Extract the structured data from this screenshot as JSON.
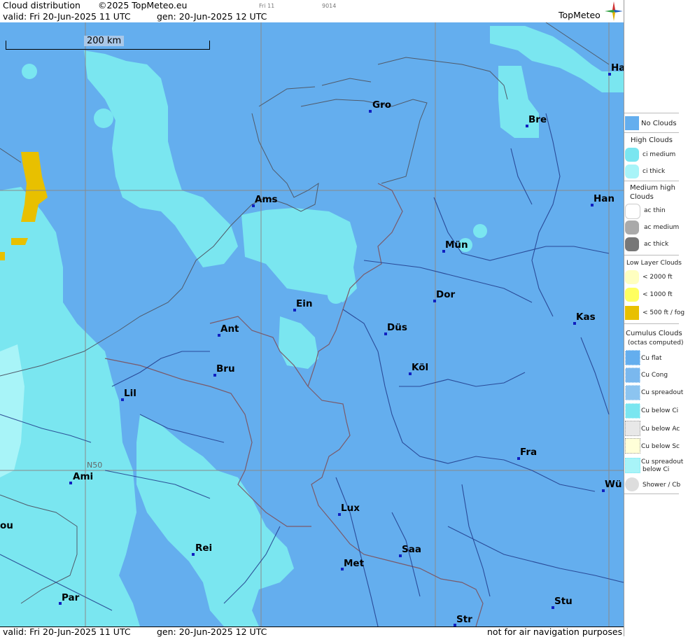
{
  "header": {
    "title": "Cloud distribution",
    "copyright": "©2025 TopMeteo.eu",
    "tab_code": "Fri 11",
    "map_code": "9014",
    "valid": "valid:  Fri  20-Jun-2025  11 UTC",
    "gen": "gen: 20-Jun-2025 12 UTC",
    "brand": "TopMeteo"
  },
  "footer": {
    "valid": "valid:  Fri  20-Jun-2025  11 UTC",
    "gen": "gen: 20-Jun-2025 12 UTC",
    "disclaimer": "not for air navigation purposes"
  },
  "map": {
    "scale_label": "200 km",
    "latitude_label": "N50",
    "cities": [
      "Gro",
      "Bre",
      "Ha",
      "Ams",
      "Han",
      "Mün",
      "Ein",
      "Dor",
      "Ant",
      "Düs",
      "Kas",
      "Bru",
      "Köl",
      "Lil",
      "Fra",
      "Ami",
      "Wü",
      "ou",
      "Lux",
      "Rei",
      "Saa",
      "Met",
      "Par",
      "Stu",
      "Str"
    ]
  },
  "legend": {
    "no_clouds": "No Clouds",
    "high_title": "High Clouds",
    "ci_medium": "ci medium",
    "ci_thick": "ci thick",
    "medium_title_1": "Medium high",
    "medium_title_2": "Clouds",
    "ac_thin": "ac thin",
    "ac_medium": "ac medium",
    "ac_thick": "ac thick",
    "low_title": "Low Layer Clouds",
    "low_2000": "< 2000 ft",
    "low_1000": "< 1000 ft",
    "low_500": "< 500 ft / fog",
    "cu_title": "Cumulus Clouds",
    "cu_sub": "(octas computed)",
    "cu_flat": "Cu flat",
    "cu_cong": "Cu Cong",
    "cu_spread": "Cu spreadout",
    "cu_below_ci": "Cu below Ci",
    "cu_below_ac": "Cu below Ac",
    "cu_below_sc": "Cu below Sc",
    "cu_spread_ci_1": "Cu spreadout",
    "cu_spread_ci_2": "below Ci",
    "shower": "Shower / Cb"
  },
  "colors": {
    "no_clouds": "#64aeee",
    "ci_medium": "#7ae6f0",
    "ci_thick": "#a8f4f8",
    "ac_thin": "#ffffff",
    "ac_medium": "#aaaaaa",
    "ac_thick": "#777777",
    "low_2000": "#ffffc0",
    "low_1000": "#ffff60",
    "low_500": "#e8c000"
  }
}
